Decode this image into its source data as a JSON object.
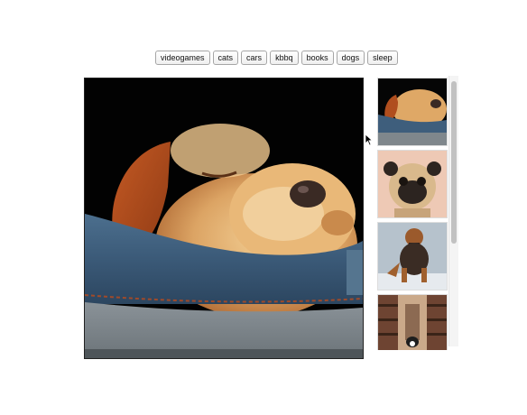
{
  "tags": [
    {
      "label": "videogames"
    },
    {
      "label": "cats"
    },
    {
      "label": "cars"
    },
    {
      "label": "kbbq"
    },
    {
      "label": "books"
    },
    {
      "label": "dogs"
    },
    {
      "label": "sleep"
    }
  ],
  "main_image": {
    "subject": "sleepy golden puppy resting in denim pocket"
  },
  "thumbnails": [
    {
      "subject": "sleepy puppy in denim pocket"
    },
    {
      "subject": "pug on pink background"
    },
    {
      "subject": "airedale terrier in snow"
    },
    {
      "subject": "dog in library aisle"
    }
  ],
  "colors": {
    "tag_border": "#a6a6a6",
    "viewer_border": "#222222",
    "scrollbar": "#c1c1c1"
  }
}
